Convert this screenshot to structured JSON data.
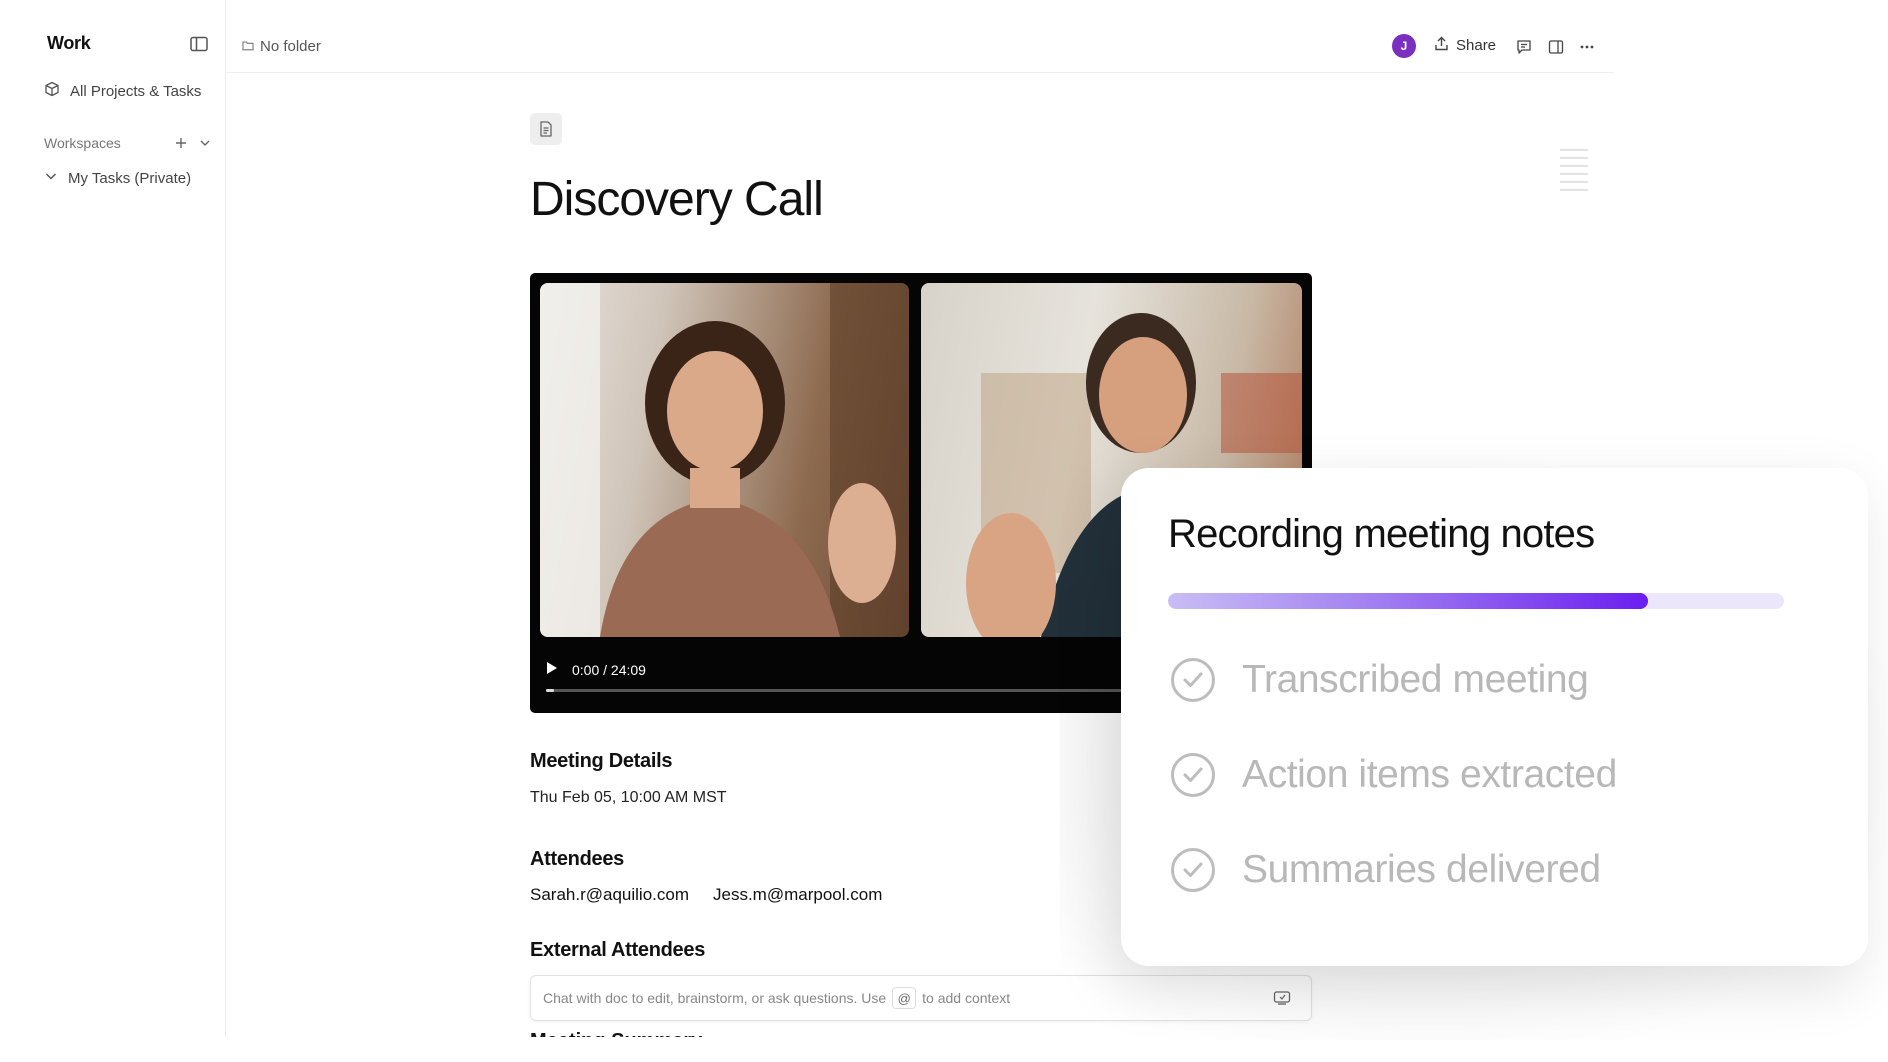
{
  "sidebar": {
    "workspace_title": "Work",
    "all_projects_label": "All Projects & Tasks",
    "workspaces_label": "Workspaces",
    "my_tasks_label": "My Tasks (Private)"
  },
  "topbar": {
    "folder_label": "No folder",
    "avatar_initial": "J",
    "share_label": "Share"
  },
  "doc": {
    "title": "Discovery Call"
  },
  "video": {
    "time_label": "0:00 / 24:09",
    "progress": 0
  },
  "details": {
    "meeting_details_heading": "Meeting Details",
    "meeting_datetime": "Thu Feb 05, 10:00 AM MST",
    "attendees_heading": "Attendees",
    "attendees": [
      "Sarah.r@aquilio.com",
      "Jess.m@marpool.com"
    ],
    "external_attendees_heading": "External Attendees",
    "next_heading_partial": "Meeting Summary"
  },
  "chat": {
    "prefix": "Chat with doc to edit, brainstorm, or ask questions. Use",
    "at_symbol": "@",
    "suffix": "to add context"
  },
  "overlay": {
    "title": "Recording meeting notes",
    "progress_percent": 78,
    "accent_color": "#6a1ef0",
    "steps": [
      "Transcribed meeting",
      "Action items extracted",
      "Summaries delivered"
    ]
  }
}
